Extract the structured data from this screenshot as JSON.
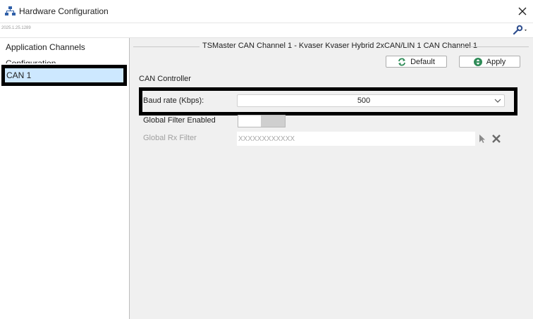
{
  "window": {
    "title": "Hardware Configuration",
    "version": "2025.1.25.1289"
  },
  "sidebar": {
    "items": [
      {
        "label": "Application Channels"
      },
      {
        "label": "Configuration"
      },
      {
        "label": "CAN 1",
        "selected": true
      }
    ]
  },
  "panel": {
    "group_title": "TSMaster CAN Channel 1 - Kvaser Kvaser Hybrid 2xCAN/LIN 1 CAN Channel 1",
    "default_label": "Default",
    "apply_label": "Apply",
    "section_label": "CAN Controller",
    "baud_rate_label": "Baud rate (Kbps):",
    "baud_rate_value": "500",
    "global_filter_label": "Global Filter Enabled",
    "global_filter_enabled": false,
    "rx_filter_label": "Global Rx Filter",
    "rx_filter_placeholder": "XXXXXXXXXXXX"
  },
  "colors": {
    "selection": "#cde8ff",
    "apply_icon": "#2e8b57",
    "default_icon": "#2e8b57",
    "panel_bg": "#f0f0f0"
  },
  "icons": {
    "app": "hierarchy-icon",
    "close": "close-icon",
    "tools": "wrench-icon",
    "default": "refresh-icon",
    "apply": "arrows-updown-icon",
    "dropdown": "chevron-down-icon",
    "pick": "cursor-icon",
    "clear": "x-icon"
  }
}
